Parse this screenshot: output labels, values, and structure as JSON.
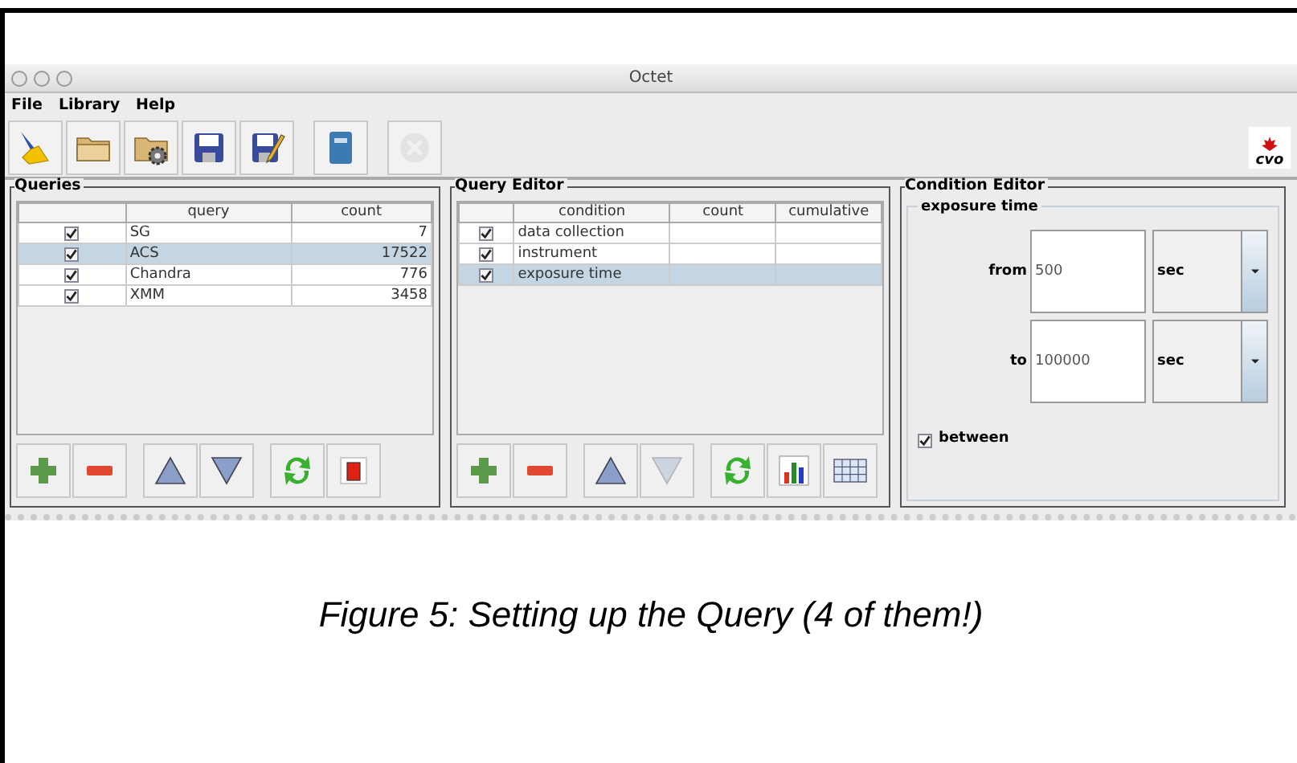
{
  "window": {
    "title": "Octet"
  },
  "menu": [
    "File",
    "Library",
    "Help"
  ],
  "toolbar": [
    {
      "kind": "brush",
      "disabled": false
    },
    {
      "kind": "folder",
      "disabled": false
    },
    {
      "kind": "folder-gear",
      "disabled": false
    },
    {
      "kind": "save",
      "disabled": false
    },
    {
      "kind": "save-edit",
      "disabled": false
    },
    {
      "kind": "book",
      "disabled": false
    },
    {
      "kind": "stop",
      "disabled": true
    }
  ],
  "logo": "cvo",
  "queries": {
    "title": "Queries",
    "columns": [
      "query",
      "count"
    ],
    "rows": [
      {
        "checked": true,
        "query": "SG",
        "count": "7",
        "selected": false
      },
      {
        "checked": true,
        "query": "ACS",
        "count": "17522",
        "selected": true
      },
      {
        "checked": true,
        "query": "Chandra",
        "count": "776",
        "selected": false
      },
      {
        "checked": true,
        "query": "XMM",
        "count": "3458",
        "selected": false
      }
    ],
    "buttons": [
      {
        "kind": "add",
        "disabled": false
      },
      {
        "kind": "remove",
        "disabled": false
      },
      {
        "kind": "up",
        "disabled": false
      },
      {
        "kind": "down",
        "disabled": false
      },
      {
        "kind": "refresh",
        "disabled": false
      },
      {
        "kind": "frame",
        "disabled": false
      }
    ]
  },
  "query_editor": {
    "title": "Query Editor",
    "columns": [
      "condition",
      "count",
      "cumulative"
    ],
    "rows": [
      {
        "checked": true,
        "condition": "data collection",
        "selected": false
      },
      {
        "checked": true,
        "condition": "instrument",
        "selected": false
      },
      {
        "checked": true,
        "condition": "exposure time",
        "selected": true
      }
    ],
    "buttons": [
      {
        "kind": "add",
        "disabled": false
      },
      {
        "kind": "remove",
        "disabled": false
      },
      {
        "kind": "up",
        "disabled": false
      },
      {
        "kind": "down",
        "disabled": true
      },
      {
        "kind": "refresh",
        "disabled": false
      },
      {
        "kind": "chart",
        "disabled": false
      },
      {
        "kind": "grid",
        "disabled": false
      }
    ]
  },
  "condition_editor": {
    "title": "Condition Editor",
    "group": "exposure time",
    "fields": [
      {
        "label": "from",
        "value": "500",
        "unit": "sec"
      },
      {
        "label": "to",
        "value": "100000",
        "unit": "sec"
      }
    ],
    "between": {
      "label": "between",
      "checked": true
    }
  },
  "caption": "Figure 5: Setting up the Query (4 of them!)"
}
